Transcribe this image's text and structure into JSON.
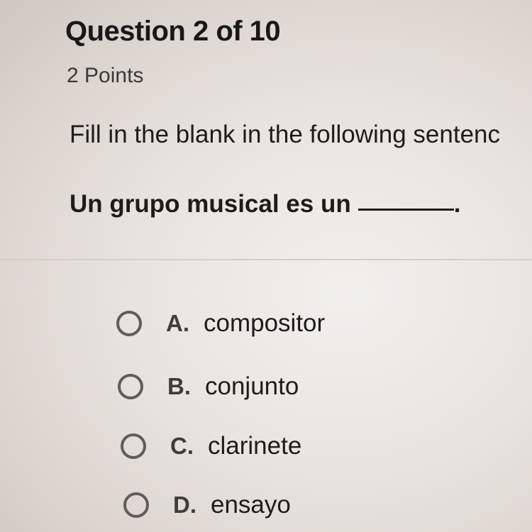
{
  "question": {
    "title": "Question 2 of 10",
    "points": "2 Points",
    "instructions": "Fill in the blank in the following sentenc",
    "sentence_prefix": "Un grupo musical es un",
    "sentence_suffix": "."
  },
  "options": [
    {
      "letter": "A.",
      "text": "compositor",
      "selected": false
    },
    {
      "letter": "B.",
      "text": "conjunto",
      "selected": false
    },
    {
      "letter": "C.",
      "text": "clarinete",
      "selected": false
    },
    {
      "letter": "D.",
      "text": "ensayo",
      "selected": false
    }
  ],
  "colors": {
    "text": "#1e1c1b",
    "radio_border": "#5f5c5a",
    "divider": "#d4cdc8"
  },
  "icons": {
    "radio": "radio-button-unchecked-icon"
  }
}
